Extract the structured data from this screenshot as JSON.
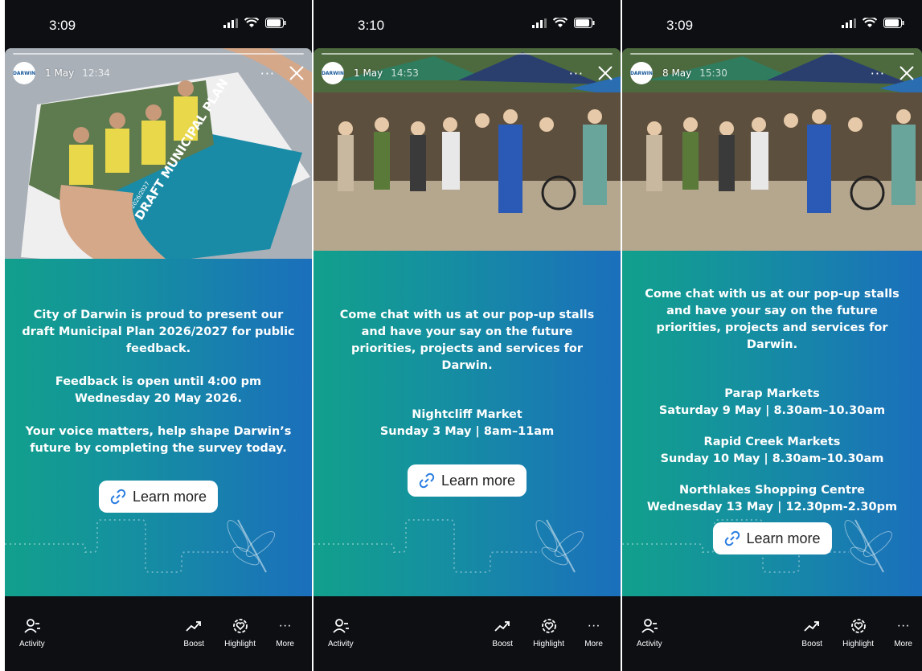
{
  "screens": [
    {
      "status_time": "3:09",
      "account": "DARWIN",
      "date": "1 May",
      "time": "12:34",
      "photo_title": "DRAFT MUNICIPAL PLAN",
      "photo_year": "2026/2027",
      "paragraphs": [
        "City of Darwin is proud to present our draft Municipal Plan 2026/2027 for public feedback.",
        "Feedback is open until 4:00 pm Wednesday 20 May 2026.",
        "Your voice matters, help shape Darwin’s future by completing the survey today."
      ],
      "cta": "Learn more"
    },
    {
      "status_time": "3:10",
      "account": "DARWIN",
      "date": "1 May",
      "time": "14:53",
      "paragraphs": [
        "Come chat with us at our pop-up stalls and have your say on the future priorities, projects and services for Darwin."
      ],
      "events": [
        {
          "name": "Nightcliff Market",
          "when": "Sunday 3 May | 8am–11am"
        }
      ],
      "cta": "Learn more"
    },
    {
      "status_time": "3:09",
      "account": "DARWIN",
      "date": "8 May",
      "time": "15:30",
      "paragraphs": [
        "Come chat with us at our pop-up stalls and have your say on the future priorities, projects and services for Darwin."
      ],
      "events": [
        {
          "name": "Parap Markets",
          "when": "Saturday 9 May | 8.30am–10.30am"
        },
        {
          "name": "Rapid Creek Markets",
          "when": "Sunday 10 May | 8.30am–10.30am"
        },
        {
          "name": "Northlakes Shopping Centre",
          "when": "Wednesday 13 May | 12.30pm-2.30pm"
        }
      ],
      "cta": "Learn more"
    }
  ],
  "bottom_bar": {
    "activity": "Activity",
    "boost": "Boost",
    "highlight": "Highlight",
    "more": "More"
  },
  "icons": [
    "signal-icon",
    "wifi-icon",
    "battery-icon",
    "more-dots-icon",
    "close-icon",
    "link-icon",
    "activity-icon",
    "boost-icon",
    "highlight-icon",
    "dragonfly-icon"
  ],
  "colors": {
    "panel_start": "#12a08c",
    "panel_end": "#1b6fbc",
    "background": "#0d0f12"
  }
}
